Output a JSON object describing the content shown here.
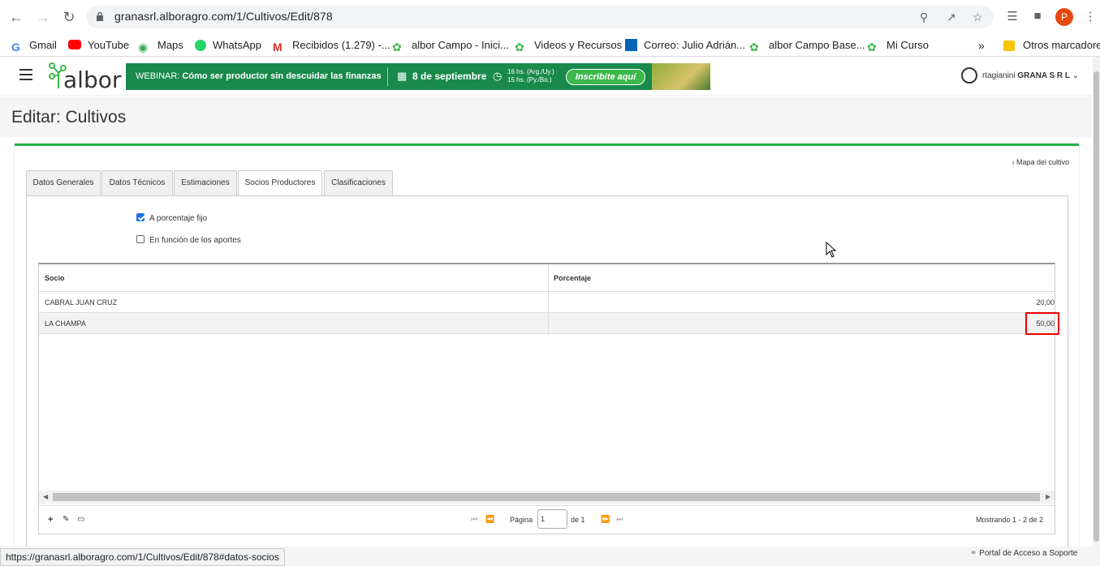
{
  "browser": {
    "url": "granasrl.alboragro.com/1/Cultivos/Edit/878",
    "profile_initial": "P",
    "status_url": "https://granasrl.alboragro.com/1/Cultivos/Edit/878#datos-socios"
  },
  "bookmarks": [
    {
      "label": "Gmail",
      "icon": "gmail-icon"
    },
    {
      "label": "YouTube",
      "icon": "youtube-icon"
    },
    {
      "label": "Maps",
      "icon": "maps-icon"
    },
    {
      "label": "WhatsApp",
      "icon": "whatsapp-icon"
    },
    {
      "label": "Recibidos (1.279) -...",
      "icon": "gmail-m-icon"
    },
    {
      "label": "albor Campo - Inici...",
      "icon": "albor-icon"
    },
    {
      "label": "Videos y Recursos",
      "icon": "albor-icon"
    },
    {
      "label": "Correo: Julio Adrián...",
      "icon": "outlook-icon"
    },
    {
      "label": "albor Campo Base...",
      "icon": "albor-icon"
    },
    {
      "label": "Mi Curso",
      "icon": "albor-icon"
    }
  ],
  "bookmarks_more": "»",
  "other_bookmarks": "Otros marcadores",
  "header": {
    "logo": "albor",
    "banner": {
      "prefix": "WEBINAR:",
      "title": "Cómo ser productor sin descuidar las finanzas",
      "date": "8 de septiembre",
      "time1": "16 hs. (Arg./Uy.)",
      "time2": "15 hs. (Py./Bo.)",
      "cta": "Inscribite aquí"
    },
    "user_name": "rtagianini",
    "company": "GRANA S R L"
  },
  "page_title": "Editar: Cultivos",
  "map_link": "Mapa del cultivo",
  "tabs": [
    {
      "label": "Datos Generales"
    },
    {
      "label": "Datos Técnicos"
    },
    {
      "label": "Estimaciones"
    },
    {
      "label": "Socios Productores",
      "active": true
    },
    {
      "label": "Clasificaciones"
    }
  ],
  "options": {
    "fixed_percentage": {
      "label": "A porcentaje fijo",
      "checked": true
    },
    "by_contributions": {
      "label": "En función de los aportes",
      "checked": false
    }
  },
  "grid": {
    "columns": [
      "Socio",
      "Porcentaje"
    ],
    "rows": [
      {
        "socio": "CABRAL JUAN CRUZ",
        "porcentaje": "20,00"
      },
      {
        "socio": "LA CHAMPA",
        "porcentaje": "50,00"
      }
    ],
    "pager": {
      "page_label": "Página",
      "page_value": "1",
      "of_label": "de 1",
      "showing": "Mostrando 1 - 2 de 2"
    }
  },
  "footer": {
    "support": "Portal de Acceso a Soporte"
  },
  "colors": {
    "accent_green": "#22b14c",
    "highlight_red": "#ee0000"
  }
}
